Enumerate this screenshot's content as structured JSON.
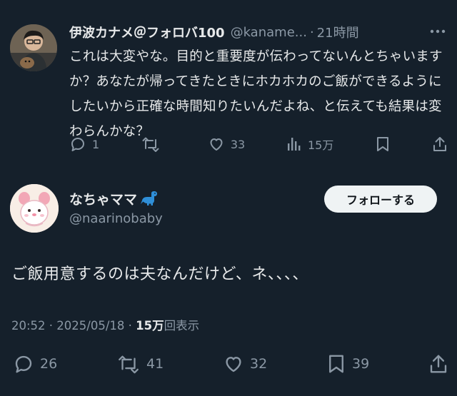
{
  "reply": {
    "name": "伊波カナメ＠フォロバ100",
    "handle": "@kaname...",
    "separator": "·",
    "time": "21時間",
    "text": "これは大変やな。目的と重要度が伝わってないんとちゃいますか？あなたが帰ってきたときにホカホカのご飯ができるようにしたいから正確な時間知りたいんだよね、と伝えても結果は変わらんかな？",
    "stats": {
      "replies": "1",
      "retweets": "",
      "likes": "33",
      "views": "15万"
    }
  },
  "tweet": {
    "name": "なちゃママ",
    "handle": "@naarinobaby",
    "follow_label": "フォローする",
    "text": "ご飯用意するのは夫なんだけど、ネ、、、、",
    "meta": {
      "time_date": "20:52 · 2025/05/18 · ",
      "views_count": "15万",
      "views_label": "回表示"
    },
    "stats": {
      "replies": "26",
      "retweets": "41",
      "likes": "32",
      "bookmarks": "39"
    }
  },
  "colors": {
    "background": "#15202b",
    "text_primary": "#e7e9ea",
    "text_secondary": "#8b98a5",
    "follow_button_bg": "#eff3f4",
    "dinosaur_emoji": "#2f8fd8"
  },
  "icons": [
    "more-icon",
    "reply-icon",
    "retweet-icon",
    "like-icon",
    "views-icon",
    "bookmark-icon",
    "share-icon",
    "dinosaur-icon"
  ]
}
